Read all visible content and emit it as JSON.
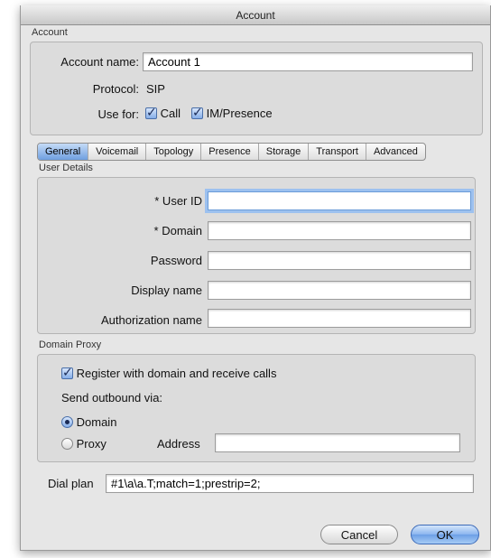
{
  "window": {
    "title": "Account"
  },
  "account_section": {
    "label": "Account",
    "account_name_label": "Account name:",
    "account_name_value": "Account 1",
    "protocol_label": "Protocol:",
    "protocol_value": "SIP",
    "use_for_label": "Use for:",
    "call_label": "Call",
    "call_checked": true,
    "im_label": "IM/Presence",
    "im_checked": true
  },
  "tabs": [
    {
      "label": "General",
      "active": true
    },
    {
      "label": "Voicemail",
      "active": false
    },
    {
      "label": "Topology",
      "active": false
    },
    {
      "label": "Presence",
      "active": false
    },
    {
      "label": "Storage",
      "active": false
    },
    {
      "label": "Transport",
      "active": false
    },
    {
      "label": "Advanced",
      "active": false
    }
  ],
  "user_details": {
    "label": "User Details",
    "user_id_label": "* User ID",
    "user_id_value": "",
    "domain_label": "* Domain",
    "domain_value": "",
    "password_label": "Password",
    "password_value": "",
    "display_name_label": "Display name",
    "display_name_value": "",
    "auth_name_label": "Authorization name",
    "auth_name_value": ""
  },
  "domain_proxy": {
    "label": "Domain Proxy",
    "register_label": "Register with domain and receive calls",
    "register_checked": true,
    "send_outbound_label": "Send outbound via:",
    "domain_option_label": "Domain",
    "proxy_option_label": "Proxy",
    "selected": "Domain",
    "address_label": "Address",
    "address_value": ""
  },
  "dial_plan": {
    "label": "Dial plan",
    "value": "#1\\a\\a.T;match=1;prestrip=2;"
  },
  "buttons": {
    "cancel_label": "Cancel",
    "ok_label": "OK"
  }
}
